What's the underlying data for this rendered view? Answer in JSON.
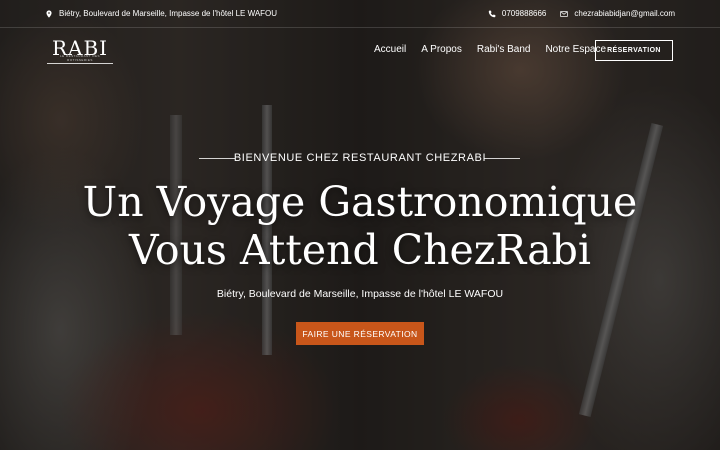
{
  "topbar": {
    "address": "Biétry, Boulevard de Marseille, Impasse de l'hôtel LE WAFOU",
    "phone": "0709888666",
    "email": "chezrabiabidjan@gmail.com"
  },
  "logo": {
    "text": "RABI",
    "tagline": "LE RESTAURANT DES ROTISSERIES"
  },
  "nav": {
    "items": [
      "Accueil",
      "A Propos",
      "Rabi's Band",
      "Notre Espace"
    ],
    "reservation": "RÉSERVATION"
  },
  "hero": {
    "kicker": "BIENVENUE CHEZ RESTAURANT CHEZRABI",
    "title_line1": "Un Voyage Gastronomique",
    "title_line2": "Vous Attend ChezRabi",
    "subtitle": "Biétry, Boulevard de Marseille, Impasse de l'hôtel LE WAFOU",
    "cta": "FAIRE UNE RÉSERVATION"
  },
  "colors": {
    "accent": "#c8561a",
    "text": "#ffffff"
  },
  "icons": [
    "map-pin-icon",
    "phone-icon",
    "mail-icon"
  ]
}
